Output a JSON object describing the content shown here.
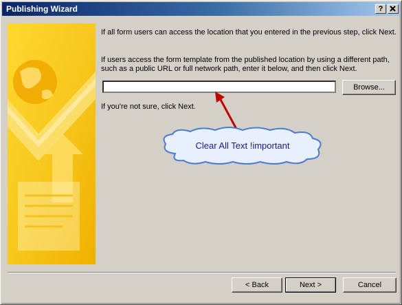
{
  "window": {
    "title": "Publishing Wizard",
    "help_glyph": "?",
    "close_glyph": "X"
  },
  "body": {
    "paragraph1": "If all form users can access the location that you entered in the previous step, click Next.",
    "paragraph2": "If users access the form template from the published location by using a different path, such as a public URL or full network path, enter it below, and then click Next.",
    "path_field_value": "",
    "browse_label": "Browse...",
    "paragraph3": "If you're not sure, click Next."
  },
  "annotation": {
    "text": "Clear All Text !important",
    "cloud_color": "#4a7bd0",
    "arrow_color": "#c00000"
  },
  "footer": {
    "back_label": "< Back",
    "next_label": "Next >",
    "cancel_label": "Cancel"
  },
  "colors": {
    "title_bar_start": "#0a246a",
    "dialog_face": "#d4d0c8",
    "panel_yellow": "#f7c81e"
  }
}
